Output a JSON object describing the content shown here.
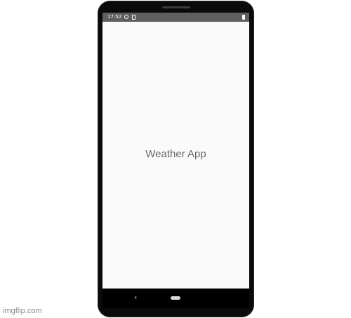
{
  "status_bar": {
    "time": "17:52",
    "icons": [
      "sync-icon",
      "sim-card-icon",
      "battery-icon"
    ]
  },
  "app": {
    "title": "Weather App"
  },
  "nav_bar": {
    "back_icon": "chevron-left-icon",
    "home_icon": "home-pill-icon",
    "back_glyph": "‹"
  },
  "watermark": {
    "text": "imgflip.com"
  },
  "colors": {
    "status_bar": "#5f5f5f",
    "screen_background": "#fafafa",
    "phone_frame": "#0a0a0a",
    "title_text": "#666666"
  }
}
